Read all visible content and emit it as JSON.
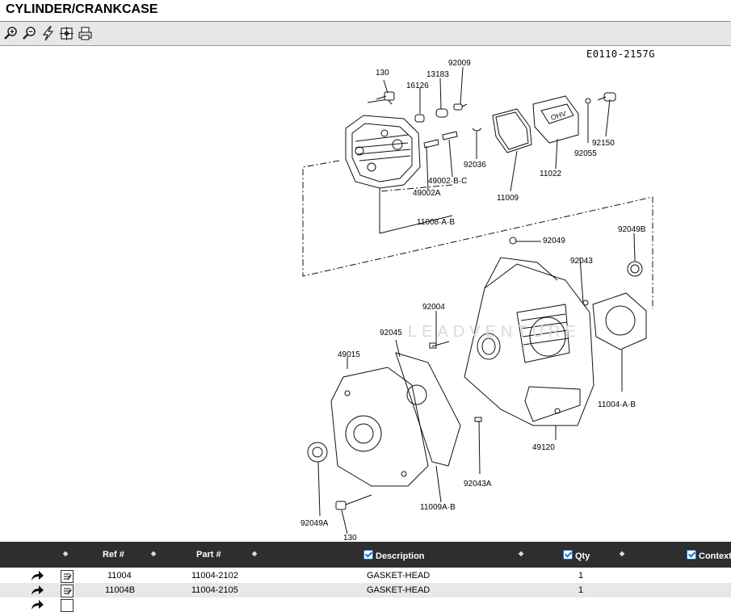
{
  "page": {
    "title": "CYLINDER/CRANKCASE"
  },
  "toolbar": {
    "icons": [
      "zoom-in-icon",
      "zoom-out-icon",
      "lightning-icon",
      "fit-icon",
      "print-icon"
    ]
  },
  "diagram": {
    "drawing_id": "E0110-2157G",
    "watermark": "LEADVENTURE",
    "labels": {
      "l130a": "130",
      "l92009": "92009",
      "l13183": "13183",
      "l16126": "16126",
      "l92036": "92036",
      "l49002bc": "49002·B·C",
      "l49002a": "49002A",
      "l11008ab": "11008·A·B",
      "l11009": "11009",
      "l11022": "11022",
      "l92055": "92055",
      "l92150": "92150",
      "l92049": "92049",
      "l92049b": "92049B",
      "l92043": "92043",
      "l92004": "92004",
      "l92045": "92045",
      "l49015": "49015",
      "l11004ab": "11004·A·B",
      "l49120": "49120",
      "l92043a": "92043A",
      "l11009ab": "11009A·B",
      "l92049a": "92049A",
      "l130b": "130"
    }
  },
  "table": {
    "headers": {
      "ref": "Ref #",
      "part": "Part #",
      "description": "Description",
      "qty": "Qty",
      "context": "Context"
    },
    "rows": [
      {
        "ref": "11004",
        "part": "11004-2102",
        "description": "GASKET-HEAD",
        "qty": "1"
      },
      {
        "ref": "11004B",
        "part": "11004-2105",
        "description": "GASKET-HEAD",
        "qty": "1"
      }
    ]
  }
}
